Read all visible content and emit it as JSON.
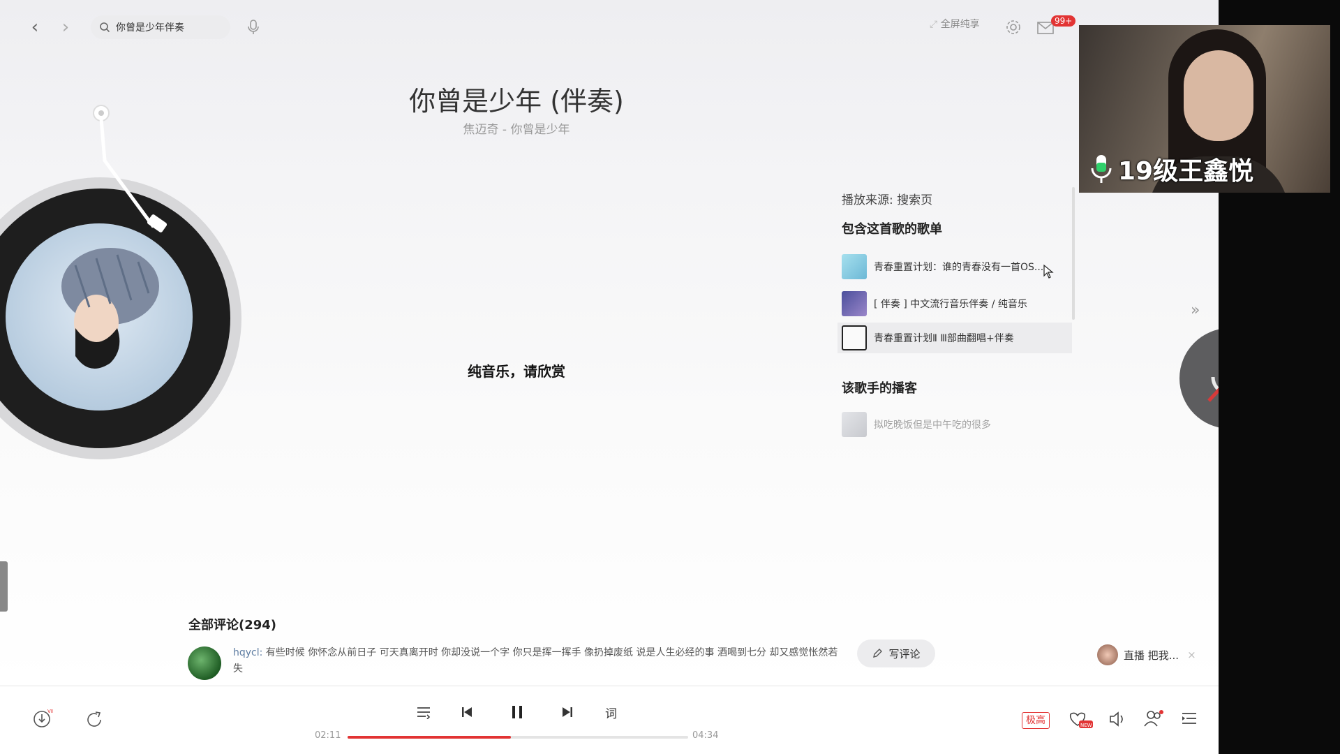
{
  "header": {
    "search_value": "你曾是少年伴奏",
    "fullscreen_label": "全屏纯享",
    "mail_badge": "99+"
  },
  "song": {
    "title": "你曾是少年 (伴奏)",
    "subtitle": "焦迈奇 - 你曾是少年",
    "center_text": "纯音乐，请欣赏"
  },
  "panel": {
    "source": "播放来源: 搜索页",
    "playlists_title": "包含这首歌的歌单",
    "playlists": [
      {
        "label": "青春重置计划：谁的青春没有一首OS...",
        "thumb_color": "#8fd0e2"
      },
      {
        "label": "[ 伴奏 ] 中文流行音乐伴奏 / 纯音乐",
        "thumb_color": "#6b6fb8"
      },
      {
        "label": "青春重置计划Ⅱ Ⅲ部曲翻唱+伴奏",
        "thumb_color": "#f4f4f4"
      }
    ],
    "podcast_title": "该歌手的播客",
    "podcast_item": "拟吃晚饭但是中午吃的很多"
  },
  "video": {
    "speaker_name": "19级王鑫悦"
  },
  "comments": {
    "title": "全部评论(294)",
    "first": {
      "user": "hqycl:",
      "text": " 有些时候 你怀念从前日子 可天真离开时 你却没说一个字 你只是挥一挥手 像扔掉废纸 说是人生必经的事 酒喝到七分 却又感觉怅然若失"
    },
    "write_label": "写评论",
    "live_label": "直播 把我..."
  },
  "player": {
    "current_time": "02:11",
    "total_time": "04:34",
    "progress": 0.48,
    "lyrics_label": "词",
    "quality_label": "极高"
  },
  "colors": {
    "accent": "#e23434"
  }
}
